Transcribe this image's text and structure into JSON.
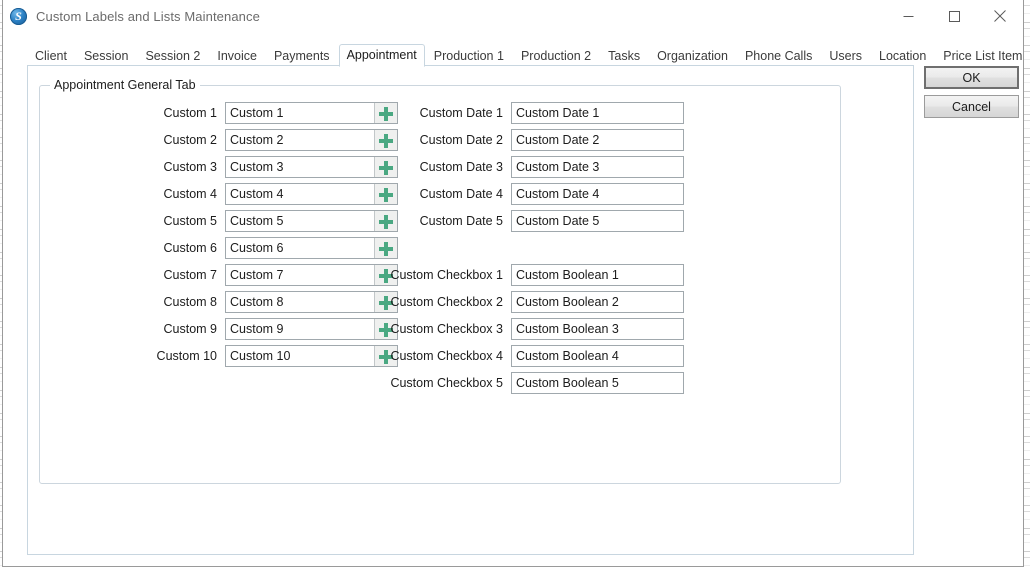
{
  "window": {
    "title": "Custom Labels and Lists Maintenance",
    "app_icon": "app-logo-icon",
    "controls": {
      "minimize": "minimize-icon",
      "maximize": "maximize-icon",
      "close": "close-icon"
    }
  },
  "tabs": [
    {
      "label": "Client",
      "selected": false
    },
    {
      "label": "Session",
      "selected": false
    },
    {
      "label": "Session 2",
      "selected": false
    },
    {
      "label": "Invoice",
      "selected": false
    },
    {
      "label": "Payments",
      "selected": false
    },
    {
      "label": "Appointment",
      "selected": true
    },
    {
      "label": "Production 1",
      "selected": false
    },
    {
      "label": "Production 2",
      "selected": false
    },
    {
      "label": "Tasks",
      "selected": false
    },
    {
      "label": "Organization",
      "selected": false
    },
    {
      "label": "Phone Calls",
      "selected": false
    },
    {
      "label": "Users",
      "selected": false
    },
    {
      "label": "Location",
      "selected": false
    },
    {
      "label": "Price List Item",
      "selected": false
    }
  ],
  "groupbox": {
    "title": "Appointment General Tab"
  },
  "custom_fields": [
    {
      "label": "Custom 1",
      "value": "Custom 1",
      "list_button": "add-list-item-icon"
    },
    {
      "label": "Custom 2",
      "value": "Custom 2",
      "list_button": "add-list-item-icon"
    },
    {
      "label": "Custom 3",
      "value": "Custom 3",
      "list_button": "add-list-item-icon"
    },
    {
      "label": "Custom 4",
      "value": "Custom 4",
      "list_button": "add-list-item-icon"
    },
    {
      "label": "Custom 5",
      "value": "Custom 5",
      "list_button": "add-list-item-icon"
    },
    {
      "label": "Custom 6",
      "value": "Custom 6",
      "list_button": "add-list-item-icon"
    },
    {
      "label": "Custom 7",
      "value": "Custom 7",
      "list_button": "add-list-item-icon"
    },
    {
      "label": "Custom 8",
      "value": "Custom 8",
      "list_button": "add-list-item-icon"
    },
    {
      "label": "Custom 9",
      "value": "Custom 9",
      "list_button": "add-list-item-icon"
    },
    {
      "label": "Custom 10",
      "value": "Custom 10",
      "list_button": "add-list-item-icon"
    }
  ],
  "custom_dates": [
    {
      "label": "Custom Date 1",
      "value": "Custom Date 1"
    },
    {
      "label": "Custom Date 2",
      "value": "Custom Date 2"
    },
    {
      "label": "Custom Date 3",
      "value": "Custom Date 3"
    },
    {
      "label": "Custom Date 4",
      "value": "Custom Date 4"
    },
    {
      "label": "Custom Date 5",
      "value": "Custom Date 5"
    }
  ],
  "custom_checkboxes": [
    {
      "label": "Custom Checkbox 1",
      "value": "Custom Boolean 1"
    },
    {
      "label": "Custom Checkbox 2",
      "value": "Custom Boolean 2"
    },
    {
      "label": "Custom Checkbox 3",
      "value": "Custom Boolean 3"
    },
    {
      "label": "Custom Checkbox 4",
      "value": "Custom Boolean 4"
    },
    {
      "label": "Custom Checkbox 5",
      "value": "Custom Boolean 5"
    }
  ],
  "dialog_buttons": {
    "ok": "OK",
    "cancel": "Cancel"
  },
  "colors": {
    "accent_green": "#4aa882",
    "tab_border": "#c8d6e0",
    "field_border": "#a0a8ad",
    "title_text": "#6b6b6b"
  }
}
